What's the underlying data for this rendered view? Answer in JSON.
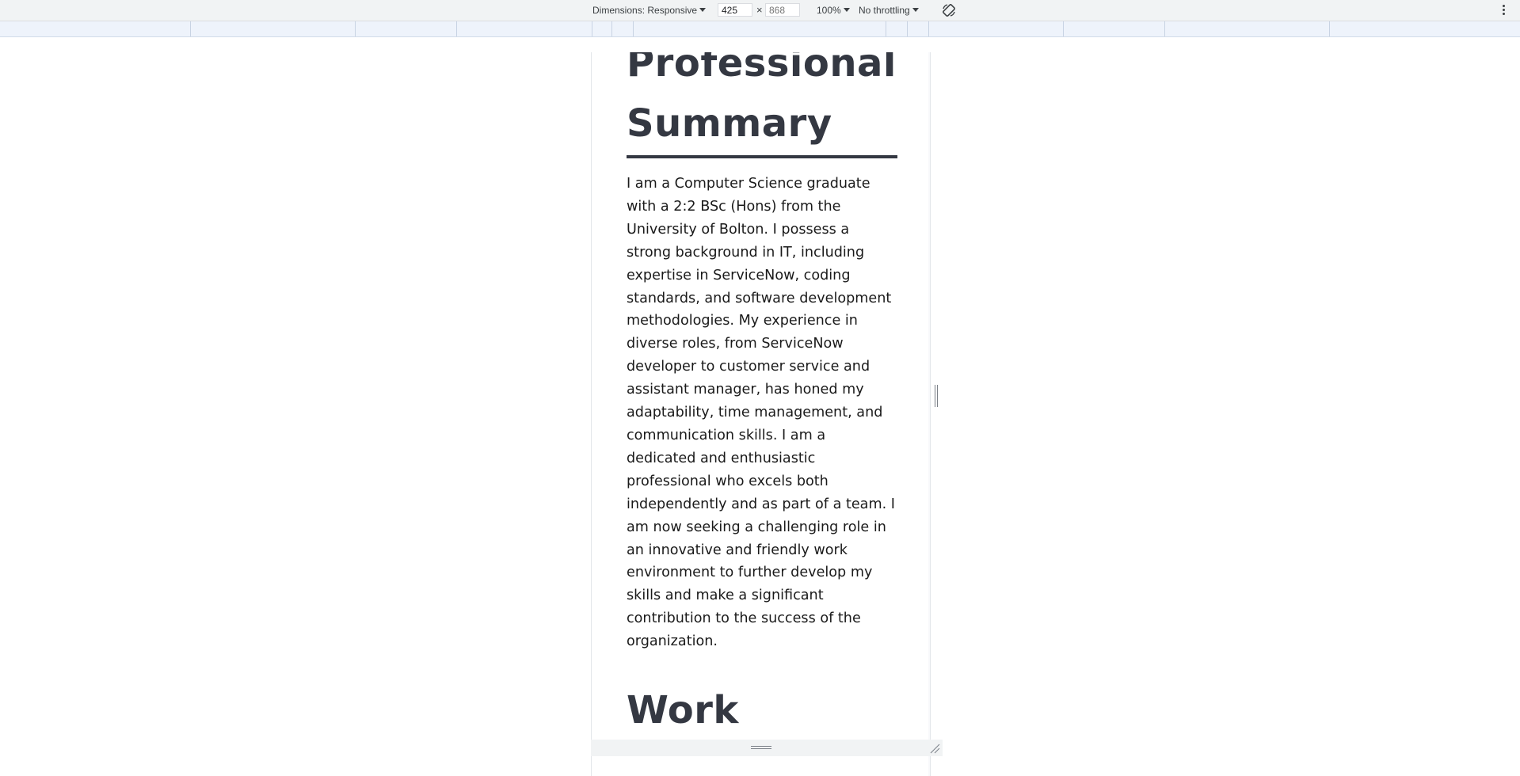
{
  "toolbar": {
    "dimensions_label": "Dimensions: Responsive",
    "width_value": "425",
    "times_sign": "×",
    "height_placeholder": "868",
    "zoom_label": "100%",
    "throttling_label": "No throttling",
    "rotate_icon": "rotate-icon",
    "more_icon": "more-vert-icon"
  },
  "page": {
    "summary_heading": "Professional Summary",
    "summary_text": "I am a Computer Science graduate with a 2:2 BSc (Hons) from the University of Bolton. I possess a strong background in IT, including expertise in ServiceNow, coding standards, and software development methodologies. My experience in diverse roles, from ServiceNow developer to customer service and assistant manager, has honed my adaptability, time management, and communication skills. I am a dedicated and enthusiastic professional who excels both independently and as part of a team. I am now seeking a challenging role in an innovative and friendly work environment to further develop my skills and make a significant contribution to the success of the organization.",
    "work_heading": "Work"
  },
  "colors": {
    "heading": "#343842",
    "card_border": "#8fcfcf",
    "card_fill": "#fdfbe6",
    "toolbar_bg": "#f1f3f4",
    "media_query_bar": "#eef3fb"
  }
}
